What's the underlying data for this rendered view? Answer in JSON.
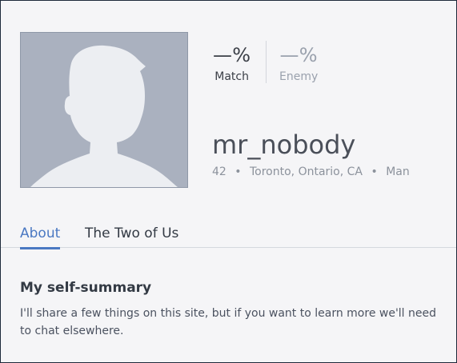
{
  "profile": {
    "username": "mr_nobody",
    "age": "42",
    "location": "Toronto, Ontario, CA",
    "gender": "Man",
    "separator": "•",
    "avatar_icon": "default-user-silhouette-icon"
  },
  "stats": {
    "match": {
      "value": "—%",
      "label": "Match"
    },
    "enemy": {
      "value": "—%",
      "label": "Enemy"
    }
  },
  "tabs": [
    {
      "label": "About",
      "active": true
    },
    {
      "label": "The Two of Us",
      "active": false
    }
  ],
  "about": {
    "heading": "My self-summary",
    "body": "I'll share a few things on this site, but if you want to learn more we'll need to chat elsewhere."
  },
  "colors": {
    "accent": "#4a78c2",
    "avatar_bg": "#aab1bf",
    "page_bg": "#f5f5f7"
  }
}
